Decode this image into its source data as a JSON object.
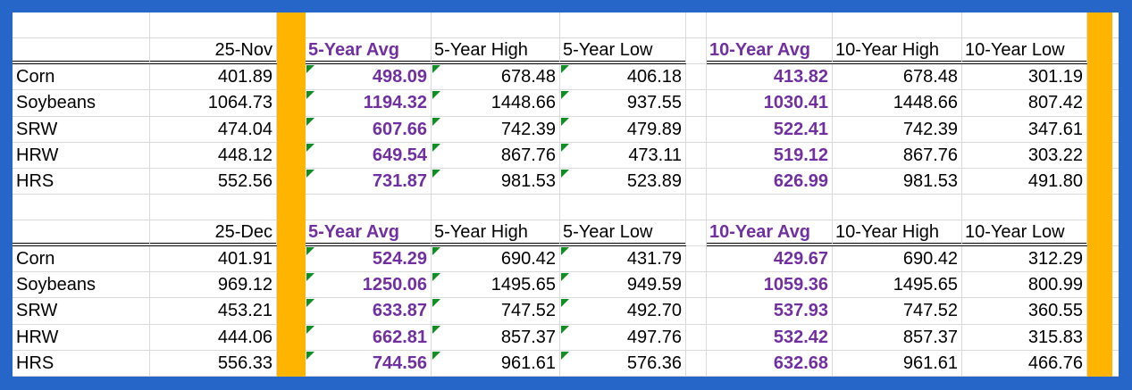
{
  "tables": [
    {
      "date": "25-Nov",
      "headers": [
        "5-Year Avg",
        "5-Year High",
        "5-Year Low",
        "10-Year Avg",
        "10-Year High",
        "10-Year Low"
      ],
      "rows": [
        {
          "label": "Corn",
          "current": "401.89",
          "avg5": "498.09",
          "high5": "678.48",
          "low5": "406.18",
          "avg10": "413.82",
          "high10": "678.48",
          "low10": "301.19"
        },
        {
          "label": "Soybeans",
          "current": "1064.73",
          "avg5": "1194.32",
          "high5": "1448.66",
          "low5": "937.55",
          "avg10": "1030.41",
          "high10": "1448.66",
          "low10": "807.42"
        },
        {
          "label": "SRW",
          "current": "474.04",
          "avg5": "607.66",
          "high5": "742.39",
          "low5": "479.89",
          "avg10": "522.41",
          "high10": "742.39",
          "low10": "347.61"
        },
        {
          "label": "HRW",
          "current": "448.12",
          "avg5": "649.54",
          "high5": "867.76",
          "low5": "473.11",
          "avg10": "519.12",
          "high10": "867.76",
          "low10": "303.22"
        },
        {
          "label": "HRS",
          "current": "552.56",
          "avg5": "731.87",
          "high5": "981.53",
          "low5": "523.89",
          "avg10": "626.99",
          "high10": "981.53",
          "low10": "491.80"
        }
      ]
    },
    {
      "date": "25-Dec",
      "headers": [
        "5-Year Avg",
        "5-Year High",
        "5-Year Low",
        "10-Year Avg",
        "10-Year High",
        "10-Year Low"
      ],
      "rows": [
        {
          "label": "Corn",
          "current": "401.91",
          "avg5": "524.29",
          "high5": "690.42",
          "low5": "431.79",
          "avg10": "429.67",
          "high10": "690.42",
          "low10": "312.29"
        },
        {
          "label": "Soybeans",
          "current": "969.12",
          "avg5": "1250.06",
          "high5": "1495.65",
          "low5": "949.59",
          "avg10": "1059.36",
          "high10": "1495.65",
          "low10": "800.99"
        },
        {
          "label": "SRW",
          "current": "453.21",
          "avg5": "633.87",
          "high5": "747.52",
          "low5": "492.70",
          "avg10": "537.93",
          "high10": "747.52",
          "low10": "360.55"
        },
        {
          "label": "HRW",
          "current": "444.06",
          "avg5": "662.81",
          "high5": "857.37",
          "low5": "497.76",
          "avg10": "532.42",
          "high10": "857.37",
          "low10": "315.83"
        },
        {
          "label": "HRS",
          "current": "556.33",
          "avg5": "744.56",
          "high5": "961.61",
          "low5": "576.36",
          "avg10": "632.68",
          "high10": "961.61",
          "low10": "466.76"
        }
      ]
    }
  ],
  "colors": {
    "background": "#2666c9",
    "highlight": "#ffb400",
    "avg_text": "#7030a0",
    "comment_marker": "#118d23"
  }
}
